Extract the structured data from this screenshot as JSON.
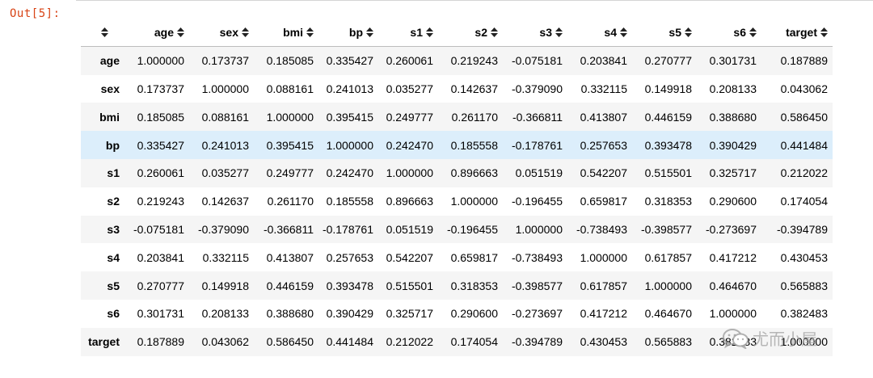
{
  "cell": {
    "prompt": "Out[5]:"
  },
  "table": {
    "columns": [
      "age",
      "sex",
      "bmi",
      "bp",
      "s1",
      "s2",
      "s3",
      "s4",
      "s5",
      "s6",
      "target"
    ],
    "highlighted_row": "bp",
    "rows": [
      {
        "label": "age",
        "values": [
          "1.000000",
          "0.173737",
          "0.185085",
          "0.335427",
          "0.260061",
          "0.219243",
          "-0.075181",
          "0.203841",
          "0.270777",
          "0.301731",
          "0.187889"
        ]
      },
      {
        "label": "sex",
        "values": [
          "0.173737",
          "1.000000",
          "0.088161",
          "0.241013",
          "0.035277",
          "0.142637",
          "-0.379090",
          "0.332115",
          "0.149918",
          "0.208133",
          "0.043062"
        ]
      },
      {
        "label": "bmi",
        "values": [
          "0.185085",
          "0.088161",
          "1.000000",
          "0.395415",
          "0.249777",
          "0.261170",
          "-0.366811",
          "0.413807",
          "0.446159",
          "0.388680",
          "0.586450"
        ]
      },
      {
        "label": "bp",
        "values": [
          "0.335427",
          "0.241013",
          "0.395415",
          "1.000000",
          "0.242470",
          "0.185558",
          "-0.178761",
          "0.257653",
          "0.393478",
          "0.390429",
          "0.441484"
        ]
      },
      {
        "label": "s1",
        "values": [
          "0.260061",
          "0.035277",
          "0.249777",
          "0.242470",
          "1.000000",
          "0.896663",
          "0.051519",
          "0.542207",
          "0.515501",
          "0.325717",
          "0.212022"
        ]
      },
      {
        "label": "s2",
        "values": [
          "0.219243",
          "0.142637",
          "0.261170",
          "0.185558",
          "0.896663",
          "1.000000",
          "-0.196455",
          "0.659817",
          "0.318353",
          "0.290600",
          "0.174054"
        ]
      },
      {
        "label": "s3",
        "values": [
          "-0.075181",
          "-0.379090",
          "-0.366811",
          "-0.178761",
          "0.051519",
          "-0.196455",
          "1.000000",
          "-0.738493",
          "-0.398577",
          "-0.273697",
          "-0.394789"
        ]
      },
      {
        "label": "s4",
        "values": [
          "0.203841",
          "0.332115",
          "0.413807",
          "0.257653",
          "0.542207",
          "0.659817",
          "-0.738493",
          "1.000000",
          "0.617857",
          "0.417212",
          "0.430453"
        ]
      },
      {
        "label": "s5",
        "values": [
          "0.270777",
          "0.149918",
          "0.446159",
          "0.393478",
          "0.515501",
          "0.318353",
          "-0.398577",
          "0.617857",
          "1.000000",
          "0.464670",
          "0.565883"
        ]
      },
      {
        "label": "s6",
        "values": [
          "0.301731",
          "0.208133",
          "0.388680",
          "0.390429",
          "0.325717",
          "0.290600",
          "-0.273697",
          "0.417212",
          "0.464670",
          "1.000000",
          "0.382483"
        ]
      },
      {
        "label": "target",
        "values": [
          "0.187889",
          "0.043062",
          "0.586450",
          "0.441484",
          "0.212022",
          "0.174054",
          "-0.394789",
          "0.430453",
          "0.565883",
          "0.382483",
          "1.000000"
        ]
      }
    ]
  },
  "watermark": {
    "text": "尤而小屋",
    "icon": "wechat-icon"
  },
  "colors": {
    "prompt": "#d84315",
    "highlight_row": "#dceefb",
    "stripe": "#f5f5f5"
  }
}
